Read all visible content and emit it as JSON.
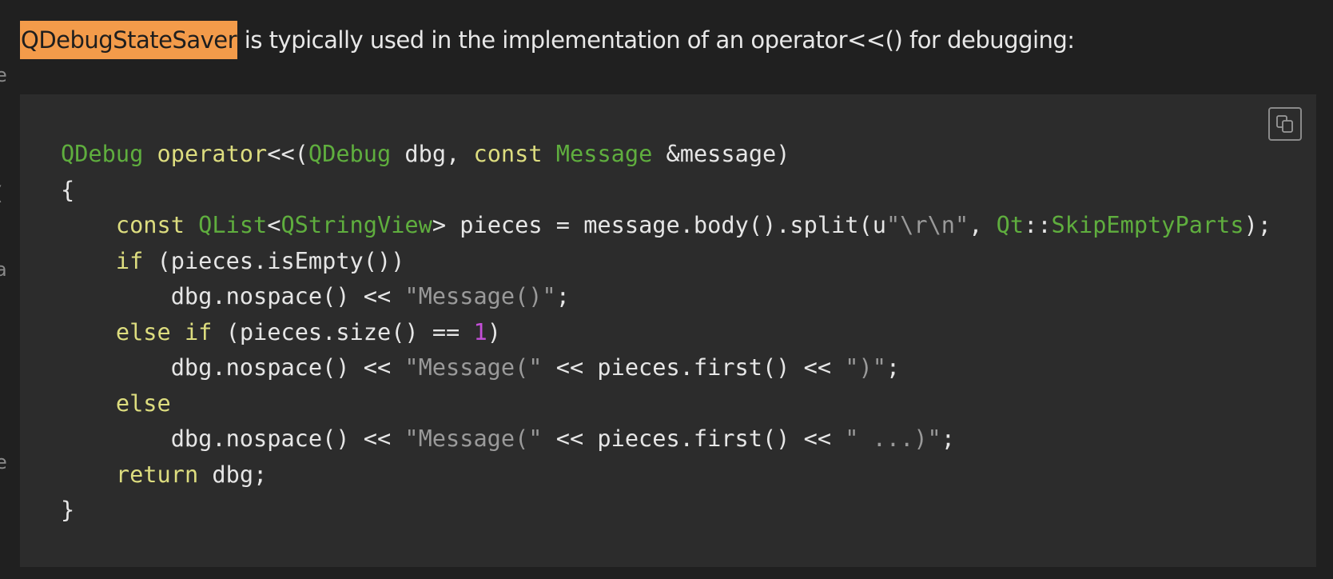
{
  "intro": {
    "highlighted_term": "QDebugStateSaver",
    "rest": " is typically used in the implementation of an operator<<() for debugging:"
  },
  "left_edge_fragments": [
    "e",
    "(",
    "a",
    "e"
  ],
  "copy_button": {
    "icon": "copy-icon"
  },
  "colors": {
    "background": "#202020",
    "code_background": "#2c2c2c",
    "highlight": "#f39b4a",
    "keyword": "#dddd7f",
    "type": "#5fae3e",
    "string": "#9a9a9a",
    "number": "#c44fd8",
    "plain": "#e6e6e6"
  },
  "code": {
    "language": "cpp",
    "lines": [
      [
        {
          "t": "QDebug",
          "k": "ty"
        },
        {
          "t": " ",
          "k": "pl"
        },
        {
          "t": "operator",
          "k": "kw"
        },
        {
          "t": "<<(",
          "k": "pl"
        },
        {
          "t": "QDebug",
          "k": "ty"
        },
        {
          "t": " dbg, ",
          "k": "pl"
        },
        {
          "t": "const",
          "k": "kw"
        },
        {
          "t": " ",
          "k": "pl"
        },
        {
          "t": "Message",
          "k": "ty"
        },
        {
          "t": " &message)",
          "k": "pl"
        }
      ],
      [
        {
          "t": "{",
          "k": "pl"
        }
      ],
      [
        {
          "t": "    ",
          "k": "pl"
        },
        {
          "t": "const",
          "k": "kw"
        },
        {
          "t": " ",
          "k": "pl"
        },
        {
          "t": "QList",
          "k": "ty"
        },
        {
          "t": "<",
          "k": "pl"
        },
        {
          "t": "QStringView",
          "k": "ty"
        },
        {
          "t": "> pieces = message.body().split(u",
          "k": "pl"
        },
        {
          "t": "\"\\r\\n\"",
          "k": "st"
        },
        {
          "t": ", ",
          "k": "pl"
        },
        {
          "t": "Qt",
          "k": "ty"
        },
        {
          "t": "::",
          "k": "pl"
        },
        {
          "t": "SkipEmptyParts",
          "k": "ty"
        },
        {
          "t": ");",
          "k": "pl"
        }
      ],
      [
        {
          "t": "    ",
          "k": "pl"
        },
        {
          "t": "if",
          "k": "kw"
        },
        {
          "t": " (pieces.isEmpty())",
          "k": "pl"
        }
      ],
      [
        {
          "t": "        dbg.nospace() << ",
          "k": "pl"
        },
        {
          "t": "\"Message()\"",
          "k": "st"
        },
        {
          "t": ";",
          "k": "pl"
        }
      ],
      [
        {
          "t": "    ",
          "k": "pl"
        },
        {
          "t": "else",
          "k": "kw"
        },
        {
          "t": " ",
          "k": "pl"
        },
        {
          "t": "if",
          "k": "kw"
        },
        {
          "t": " (pieces.size() == ",
          "k": "pl"
        },
        {
          "t": "1",
          "k": "nu"
        },
        {
          "t": ")",
          "k": "pl"
        }
      ],
      [
        {
          "t": "        dbg.nospace() << ",
          "k": "pl"
        },
        {
          "t": "\"Message(\"",
          "k": "st"
        },
        {
          "t": " << pieces.first() << ",
          "k": "pl"
        },
        {
          "t": "\")\"",
          "k": "st"
        },
        {
          "t": ";",
          "k": "pl"
        }
      ],
      [
        {
          "t": "    ",
          "k": "pl"
        },
        {
          "t": "else",
          "k": "kw"
        }
      ],
      [
        {
          "t": "        dbg.nospace() << ",
          "k": "pl"
        },
        {
          "t": "\"Message(\"",
          "k": "st"
        },
        {
          "t": " << pieces.first() << ",
          "k": "pl"
        },
        {
          "t": "\" ...)\"",
          "k": "st"
        },
        {
          "t": ";",
          "k": "pl"
        }
      ],
      [
        {
          "t": "    ",
          "k": "pl"
        },
        {
          "t": "return",
          "k": "kw"
        },
        {
          "t": " dbg;",
          "k": "pl"
        }
      ],
      [
        {
          "t": "}",
          "k": "pl"
        }
      ]
    ]
  }
}
